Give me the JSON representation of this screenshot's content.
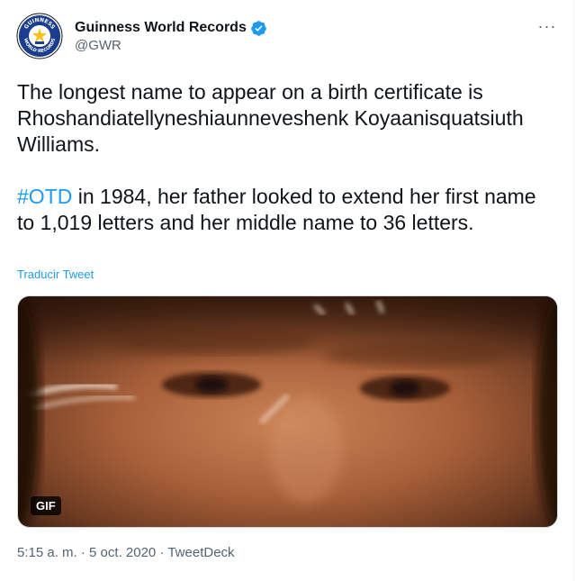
{
  "tweet": {
    "display_name": "Guinness World Records",
    "handle": "@GWR",
    "more_label": "···",
    "avatar": {
      "ring_text_top": "GUINNESS",
      "ring_text_bottom": "WORLD RECORDS"
    },
    "paragraph1": "The longest name to appear on a birth certificate is Rhoshandiatellyneshiaunneveshenk Koyaanisquatsiuth Williams.",
    "hashtag": "#OTD",
    "paragraph2_rest": " in 1984, her father looked to extend her first name to 1,019 letters and her middle name to 36 letters.",
    "translate_label": "Traducir Tweet",
    "media": {
      "badge": "GIF"
    },
    "time": "5:15 a. m.",
    "separator": " · ",
    "date": "5 oct. 2020",
    "source": "TweetDeck"
  },
  "colors": {
    "accent": "#1d9bf0",
    "text": "#0f1419",
    "secondary": "#536471"
  },
  "icons": {
    "verified": "verified-badge-icon",
    "more": "more-options-icon"
  }
}
